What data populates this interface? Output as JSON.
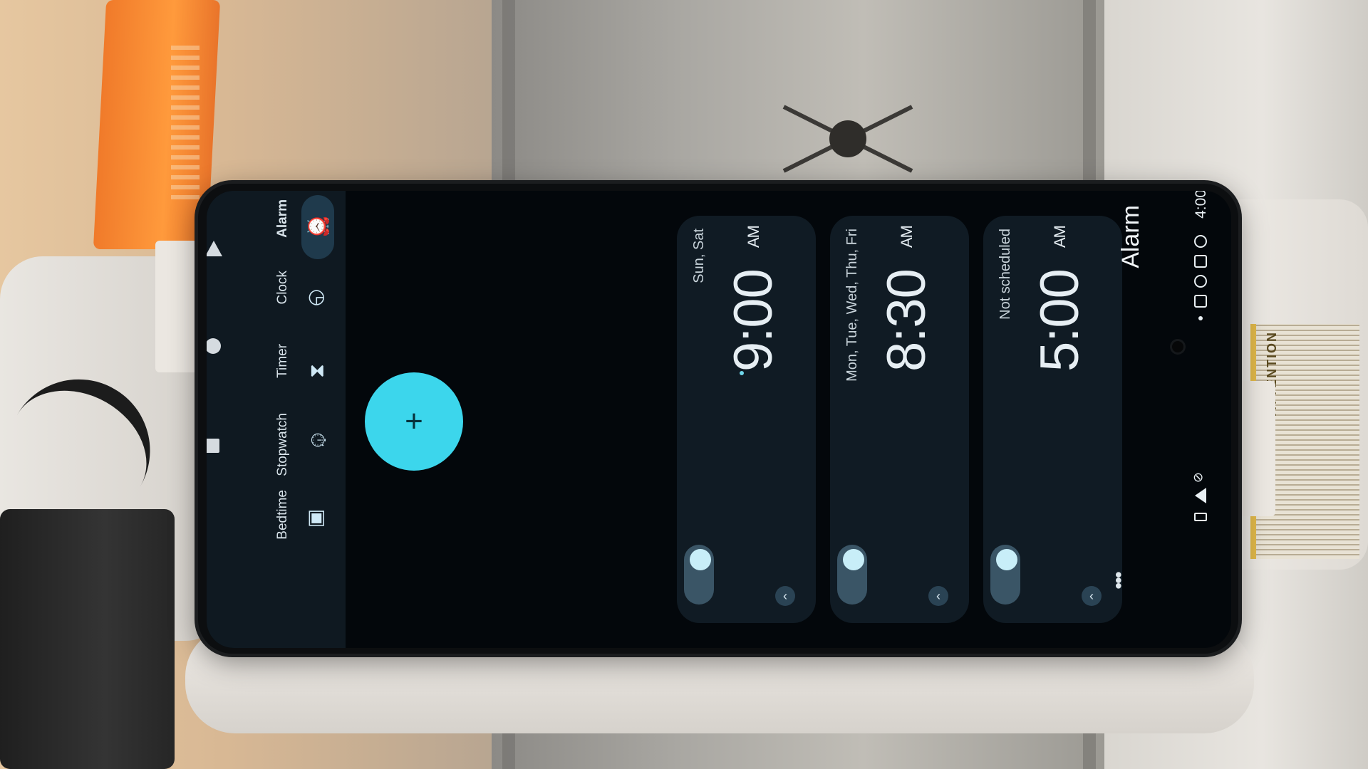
{
  "status_bar": {
    "time": "4:00"
  },
  "header": {
    "title": "Alarm"
  },
  "alarms": [
    {
      "time": "5:00",
      "period": "AM",
      "schedule": "Not scheduled",
      "enabled": true
    },
    {
      "time": "8:30",
      "period": "AM",
      "schedule": "Mon, Tue, Wed, Thu, Fri",
      "enabled": true
    },
    {
      "time": "9:00",
      "period": "AM",
      "schedule": "Sun, Sat",
      "enabled": true
    }
  ],
  "fab": {
    "label": "+"
  },
  "nav": {
    "items": [
      {
        "label": "Alarm",
        "icon": "alarm-icon",
        "active": true
      },
      {
        "label": "Clock",
        "icon": "clock-icon",
        "active": false
      },
      {
        "label": "Timer",
        "icon": "hourglass-icon",
        "active": false
      },
      {
        "label": "Stopwatch",
        "icon": "stopwatch-icon",
        "active": false
      },
      {
        "label": "Bedtime",
        "icon": "bed-icon",
        "active": false
      }
    ]
  },
  "colors": {
    "accent": "#3cd6ec",
    "background": "#03070b",
    "card": "#101b24"
  }
}
